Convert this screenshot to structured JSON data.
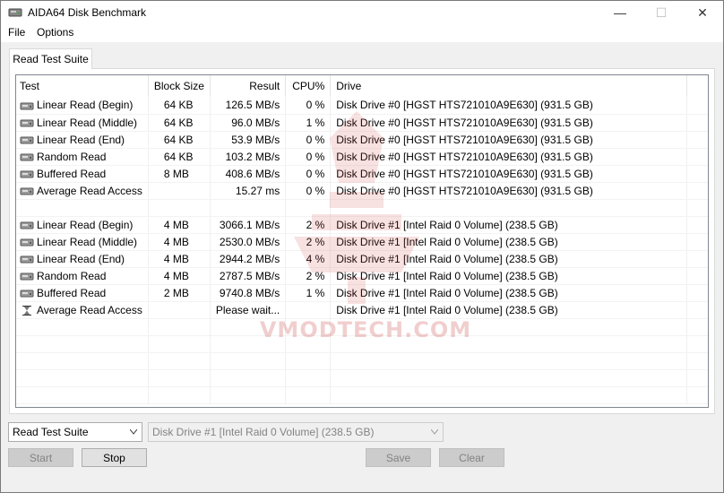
{
  "window": {
    "title": "AIDA64 Disk Benchmark",
    "min_glyph": "—",
    "max_glyph": "☐",
    "close_glyph": "✕"
  },
  "menu": {
    "file": "File",
    "options": "Options"
  },
  "tab": {
    "label": "Read Test Suite"
  },
  "table": {
    "headers": {
      "test": "Test",
      "block": "Block Size",
      "result": "Result",
      "cpu": "CPU%",
      "drive": "Drive"
    },
    "rows": [
      {
        "test": "Linear Read (Begin)",
        "block": "64 KB",
        "result": "126.5 MB/s",
        "cpu": "0 %",
        "drive": "Disk Drive #0  [HGST HTS721010A9E630]  (931.5 GB)"
      },
      {
        "test": "Linear Read (Middle)",
        "block": "64 KB",
        "result": "96.0 MB/s",
        "cpu": "1 %",
        "drive": "Disk Drive #0  [HGST HTS721010A9E630]  (931.5 GB)"
      },
      {
        "test": "Linear Read (End)",
        "block": "64 KB",
        "result": "53.9 MB/s",
        "cpu": "0 %",
        "drive": "Disk Drive #0  [HGST HTS721010A9E630]  (931.5 GB)"
      },
      {
        "test": "Random Read",
        "block": "64 KB",
        "result": "103.2 MB/s",
        "cpu": "0 %",
        "drive": "Disk Drive #0  [HGST HTS721010A9E630]  (931.5 GB)"
      },
      {
        "test": "Buffered Read",
        "block": "8 MB",
        "result": "408.6 MB/s",
        "cpu": "0 %",
        "drive": "Disk Drive #0  [HGST HTS721010A9E630]  (931.5 GB)"
      },
      {
        "test": "Average Read Access",
        "block": "",
        "result": "15.27 ms",
        "cpu": "0 %",
        "drive": "Disk Drive #0  [HGST HTS721010A9E630]  (931.5 GB)"
      },
      {
        "test": "",
        "block": "",
        "result": "",
        "cpu": "",
        "drive": ""
      },
      {
        "test": "Linear Read (Begin)",
        "block": "4 MB",
        "result": "3066.1 MB/s",
        "cpu": "2 %",
        "drive": "Disk Drive #1  [Intel   Raid 0 Volume]  (238.5 GB)"
      },
      {
        "test": "Linear Read (Middle)",
        "block": "4 MB",
        "result": "2530.0 MB/s",
        "cpu": "2 %",
        "drive": "Disk Drive #1  [Intel   Raid 0 Volume]  (238.5 GB)"
      },
      {
        "test": "Linear Read (End)",
        "block": "4 MB",
        "result": "2944.2 MB/s",
        "cpu": "4 %",
        "drive": "Disk Drive #1  [Intel   Raid 0 Volume]  (238.5 GB)"
      },
      {
        "test": "Random Read",
        "block": "4 MB",
        "result": "2787.5 MB/s",
        "cpu": "2 %",
        "drive": "Disk Drive #1  [Intel   Raid 0 Volume]  (238.5 GB)"
      },
      {
        "test": "Buffered Read",
        "block": "2 MB",
        "result": "9740.8 MB/s",
        "cpu": "1 %",
        "drive": "Disk Drive #1  [Intel   Raid 0 Volume]  (238.5 GB)"
      },
      {
        "test": "Average Read Access",
        "block": "",
        "result": "Please wait...",
        "cpu": "",
        "drive": "Disk Drive #1  [Intel   Raid 0 Volume]  (238.5 GB)"
      }
    ]
  },
  "icons": {
    "drive": "disk-drive-icon",
    "pending": "hourglass-icon"
  },
  "watermark": {
    "text": "VMODTECH.COM"
  },
  "controls": {
    "test_select": "Read Test Suite",
    "drive_select": "Disk Drive #1  [Intel   Raid 0 Volume]  (238.5 GB)",
    "start": "Start",
    "stop": "Stop",
    "save": "Save",
    "clear": "Clear"
  }
}
